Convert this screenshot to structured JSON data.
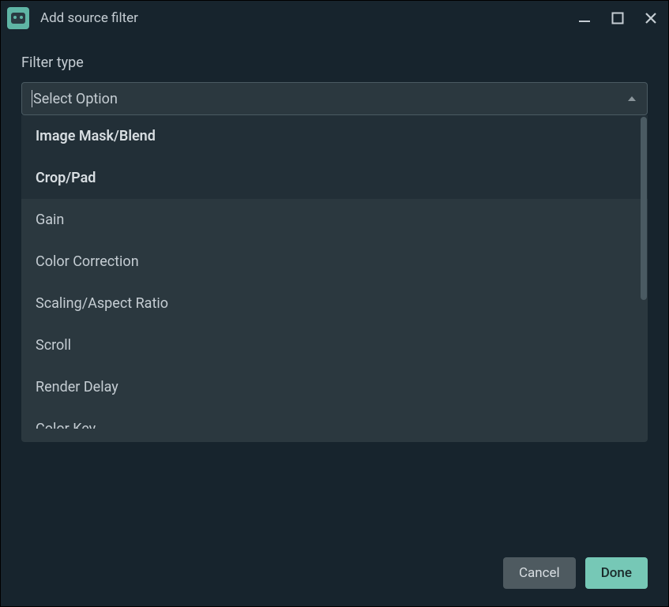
{
  "window": {
    "title": "Add source filter"
  },
  "form": {
    "filter_type_label": "Filter type",
    "select_placeholder": "Select Option"
  },
  "options": [
    {
      "label": "Image Mask/Blend",
      "highlighted": true
    },
    {
      "label": "Crop/Pad",
      "highlighted": true
    },
    {
      "label": "Gain",
      "highlighted": false
    },
    {
      "label": "Color Correction",
      "highlighted": false
    },
    {
      "label": "Scaling/Aspect Ratio",
      "highlighted": false
    },
    {
      "label": "Scroll",
      "highlighted": false
    },
    {
      "label": "Render Delay",
      "highlighted": false
    },
    {
      "label": "Color Key",
      "highlighted": false,
      "partial": true
    }
  ],
  "buttons": {
    "cancel": "Cancel",
    "done": "Done"
  }
}
